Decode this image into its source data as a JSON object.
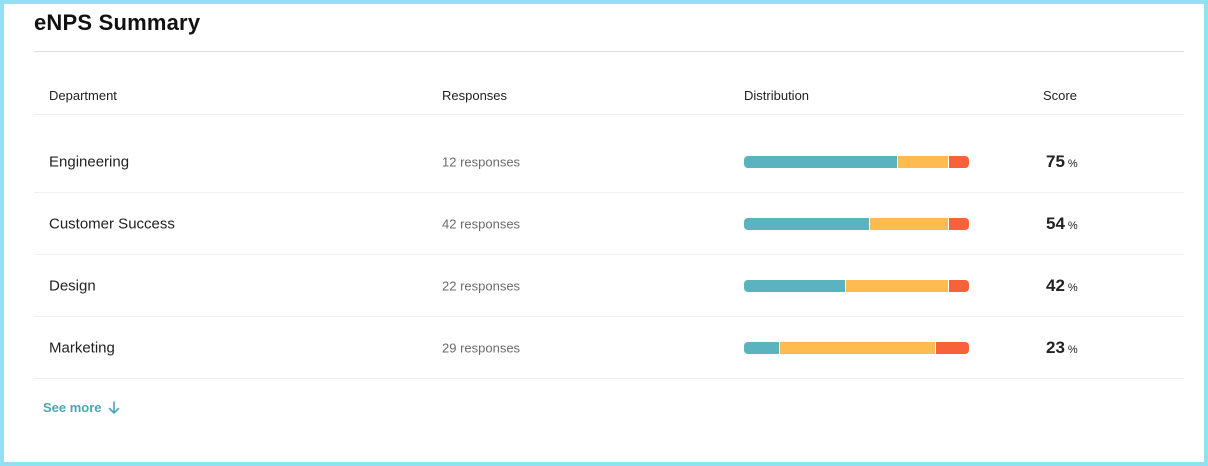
{
  "card": {
    "title": "eNPS Summary"
  },
  "table": {
    "headers": {
      "department": "Department",
      "responses": "Responses",
      "distribution": "Distribution",
      "score": "Score"
    },
    "rows": [
      {
        "department": "Engineering",
        "responses": "12 responses",
        "distribution": {
          "promoter": 0.685,
          "passive": 0.225,
          "detractor": 0.09
        },
        "score": "75",
        "score_unit": "%"
      },
      {
        "department": "Customer Success",
        "responses": "42 responses",
        "distribution": {
          "promoter": 0.56,
          "passive": 0.35,
          "detractor": 0.09
        },
        "score": "54",
        "score_unit": "%"
      },
      {
        "department": "Design",
        "responses": "22 responses",
        "distribution": {
          "promoter": 0.455,
          "passive": 0.455,
          "detractor": 0.09
        },
        "score": "42",
        "score_unit": "%"
      },
      {
        "department": "Marketing",
        "responses": "29 responses",
        "distribution": {
          "promoter": 0.16,
          "passive": 0.695,
          "detractor": 0.145
        },
        "score": "23",
        "score_unit": "%"
      }
    ]
  },
  "see_more": {
    "label": "See more",
    "icon": "arrow-down-icon"
  },
  "colors": {
    "promoter": "#5bb3c0",
    "passive": "#fdbb50",
    "detractor": "#f7623b",
    "link": "#4aa5b5",
    "frame": "#92e0f4"
  }
}
